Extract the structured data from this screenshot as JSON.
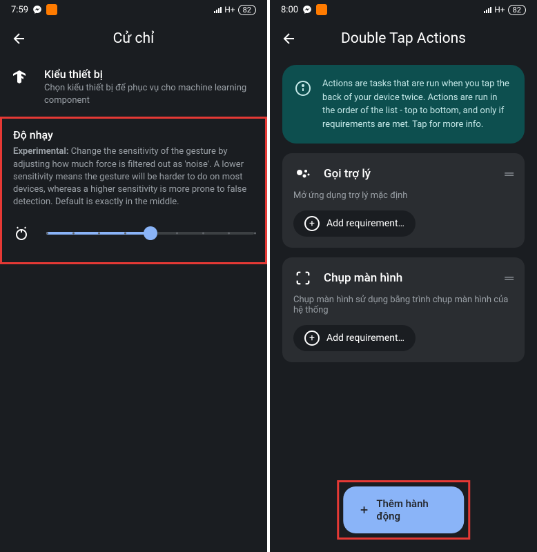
{
  "left": {
    "status": {
      "time": "7:59",
      "network": "H+",
      "battery": "82"
    },
    "header": {
      "title": "Cử chỉ"
    },
    "deviceType": {
      "title": "Kiểu thiết bị",
      "desc": "Chọn kiểu thiết bị để phục vụ cho machine learning component"
    },
    "sensitivity": {
      "title": "Độ nhạy",
      "experimental": "Experimental:",
      "desc": "Change the sensitivity of the gesture by adjusting how much force is filtered out as 'noise'. A lower sensitivity means the gesture will be harder to do on most devices, whereas a higher sensitivity is more prone to false detection. Default is exactly in the middle."
    }
  },
  "right": {
    "status": {
      "time": "8:00",
      "network": "H+",
      "battery": "82"
    },
    "header": {
      "title": "Double Tap Actions"
    },
    "info": {
      "text": "Actions are tasks that are run when you tap the back of your device twice. Actions are run in the order of the list - top to bottom, and only if requirements are met. Tap for more info."
    },
    "action1": {
      "title": "Gọi trợ lý",
      "desc": "Mở ứng dụng trợ lý mặc định",
      "addBtn": "Add requirement…"
    },
    "action2": {
      "title": "Chụp màn hình",
      "desc": "Chụp màn hình sử dụng bằng trình chụp màn hình của hệ thống",
      "addBtn": "Add requirement…"
    },
    "fab": {
      "label": "Thêm hành động"
    }
  }
}
